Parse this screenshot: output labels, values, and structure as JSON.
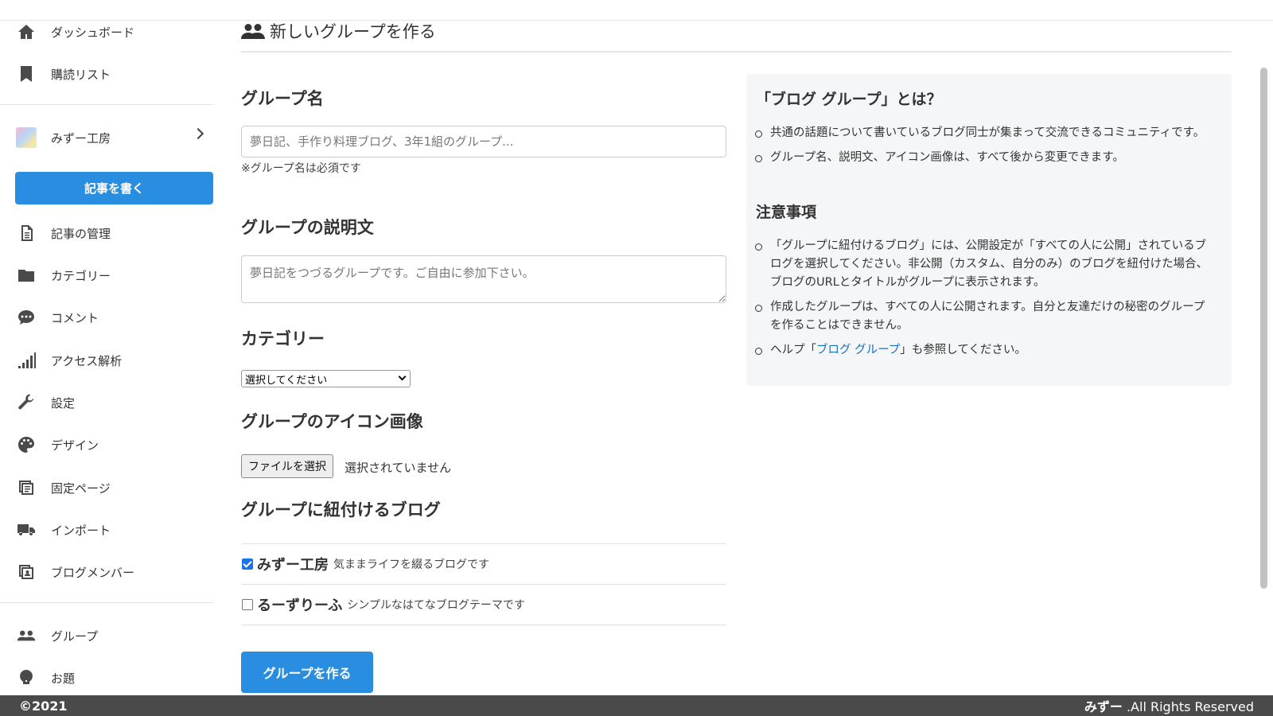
{
  "sidebar": {
    "items": [
      {
        "label": "ダッシュボード",
        "icon": "home-icon"
      },
      {
        "label": "購読リスト",
        "icon": "bookmark-icon"
      },
      {
        "label": "みずー工房",
        "icon": "blog-thumbnail"
      },
      {
        "label": "記事の管理",
        "icon": "document-icon"
      },
      {
        "label": "カテゴリー",
        "icon": "folder-icon"
      },
      {
        "label": "コメント",
        "icon": "comment-icon"
      },
      {
        "label": "アクセス解析",
        "icon": "signal-bars-icon"
      },
      {
        "label": "設定",
        "icon": "wrench-icon"
      },
      {
        "label": "デザイン",
        "icon": "palette-icon"
      },
      {
        "label": "固定ページ",
        "icon": "pages-icon"
      },
      {
        "label": "インポート",
        "icon": "truck-icon"
      },
      {
        "label": "ブログメンバー",
        "icon": "member-icon"
      },
      {
        "label": "グループ",
        "icon": "group-icon"
      },
      {
        "label": "お題",
        "icon": "topic-icon"
      }
    ],
    "write_button": "記事を書く"
  },
  "main": {
    "title": "新しいグループを作る",
    "group_name": {
      "heading": "グループ名",
      "placeholder": "夢日記、手作り料理ブログ、3年1組のグループ...",
      "note": "※グループ名は必須です"
    },
    "description": {
      "heading": "グループの説明文",
      "placeholder": "夢日記をつづるグループです。ご自由に参加下さい。"
    },
    "category": {
      "heading": "カテゴリー",
      "selected": "選択してください"
    },
    "icon_image": {
      "heading": "グループのアイコン画像",
      "button": "ファイルを選択",
      "status": "選択されていません"
    },
    "linked_blogs": {
      "heading": "グループに紐付けるブログ",
      "blogs": [
        {
          "name": "みずー工房",
          "desc": "気ままライフを綴るブログです",
          "checked": true
        },
        {
          "name": "るーずりーふ",
          "desc": "シンプルなはてなブログテーマです",
          "checked": false
        }
      ]
    },
    "submit": "グループを作る"
  },
  "info": {
    "heading1": "「ブログ グループ」とは？",
    "list1": [
      "共通の話題について書いているブログ同士が集まって交流できるコミュニティです。",
      "グループ名、説明文、アイコン画像は、すべて後から変更できます。"
    ],
    "heading2": "注意事項",
    "list2": [
      "「グループに紐付けるブログ」には、公開設定が「すべての人に公開」されているブログを選択してください。非公開（カスタム、自分のみ）のブログを紐付けた場合、ブログのURLとタイトルがグループに表示されます。",
      "作成したグループは、すべての人に公開されます。自分と友達だけの秘密のグループを作ることはできません。"
    ],
    "help_prefix": "ヘルプ「",
    "help_link": "ブログ グループ",
    "help_suffix": "」も参照してください。"
  },
  "footer": {
    "copyright": "©2021",
    "owner": "みずー",
    "rights": " .All Rights Reserved"
  },
  "colors": {
    "accent": "#2a8ee0",
    "link": "#1a6fc4",
    "footer_bg": "#4a4a4a",
    "panel_bg": "#f5f6f7"
  }
}
